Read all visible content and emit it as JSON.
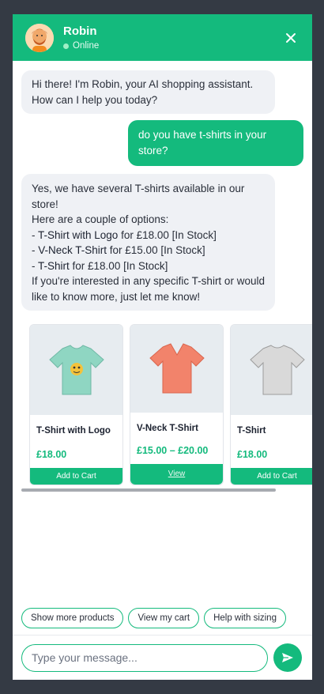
{
  "header": {
    "agent_name": "Robin",
    "status": "Online"
  },
  "messages": {
    "greeting": {
      "line1": "Hi there! I'm Robin, your AI shopping assistant.",
      "line2": "How can I help you today?"
    },
    "user_question": "do you have t-shirts in your store?",
    "reply": {
      "intro1": "Yes, we have several T-shirts available in our store!",
      "intro2": "Here are a couple of options:",
      "items": [
        {
          "prefix": "- ",
          "name": "T-Shirt with Logo",
          "detail": " for £18.00 [In Stock]"
        },
        {
          "prefix": "- ",
          "name": "V-Neck T-Shirt",
          "detail": " for £15.00 [In Stock]"
        },
        {
          "prefix": "- ",
          "name": "T-Shirt",
          "detail": " for £18.00 [In Stock]"
        }
      ],
      "outro1": "If you're interested in any specific T-shirt or would",
      "outro2": "like to know more, just let me know!"
    }
  },
  "products": [
    {
      "name": "T-Shirt with Logo",
      "price": "£18.00",
      "button": "Add to Cart",
      "color": "#8fd6c2"
    },
    {
      "name": "V-Neck T-Shirt",
      "price": "£15.00 – £20.00",
      "button": "View",
      "color": "#f2836b"
    },
    {
      "name": "T-Shirt",
      "price": "£18.00",
      "button": "Add to Cart",
      "color": "#d9d9d9"
    }
  ],
  "quick_replies": [
    "Show more products",
    "View my cart",
    "Help with sizing"
  ],
  "composer": {
    "placeholder": "Type your message..."
  },
  "colors": {
    "accent": "#14ba7d",
    "background": "#343a44"
  }
}
